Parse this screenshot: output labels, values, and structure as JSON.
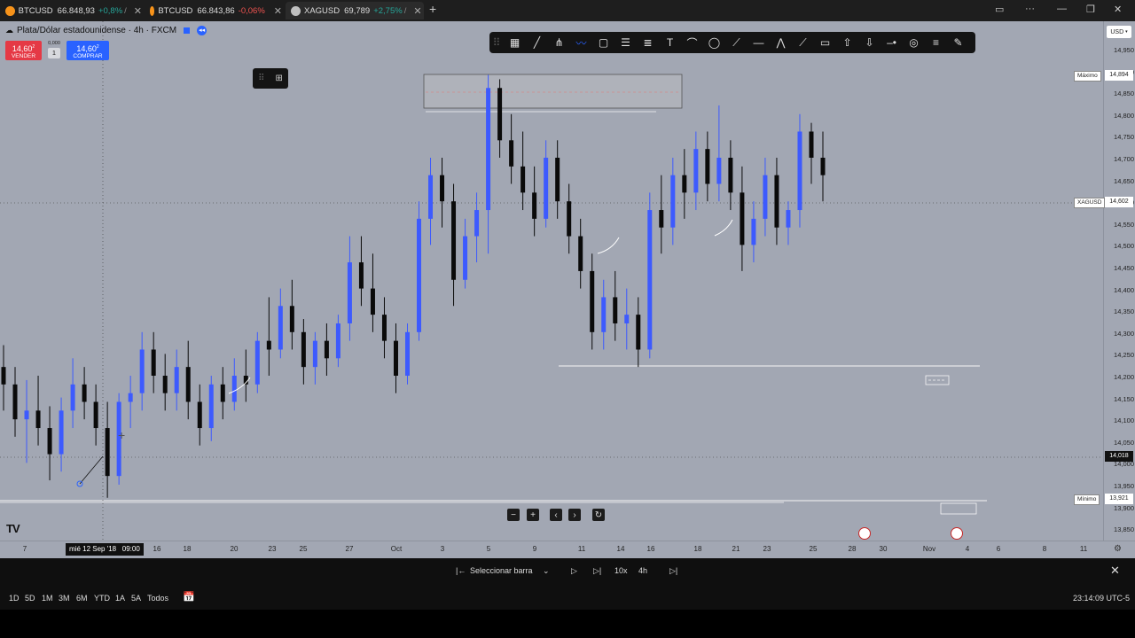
{
  "tabs": [
    {
      "symbol": "BTCUSD",
      "price": "66.848,93",
      "change": "+0,8%",
      "direction": "up",
      "suffix": "/",
      "coin_color": "#f7931a",
      "active": false
    },
    {
      "symbol": "BTCUSD",
      "price": "66.843,86",
      "change": "-0,06%",
      "direction": "down",
      "suffix": "",
      "coin_color": "#f7931a",
      "active": false
    },
    {
      "symbol": "XAGUSD",
      "price": "69,789",
      "change": "+2,75%",
      "direction": "up",
      "suffix": "/ ",
      "coin_color": "#c0c0c0",
      "active": true
    }
  ],
  "window_controls": {
    "new_tab": "+",
    "dots": "···",
    "minimize": "—",
    "restore": "❐",
    "close": "✕"
  },
  "header": {
    "title": "Plata/Dólar estadounidense · 4h · FXCM"
  },
  "trade": {
    "sell_price": "14,60",
    "sell_sup": "2",
    "sell_label": "VENDER",
    "spread_top": "0,000",
    "spread": "1",
    "buy_price": "14,60",
    "buy_sup": "2",
    "buy_label": "COMPRAR"
  },
  "currency_button": "USD",
  "price_labels": [
    "14,950",
    "14,900",
    "14,850",
    "14,800",
    "14,750",
    "14,700",
    "14,650",
    "14,600",
    "14,550",
    "14,500",
    "14,450",
    "14,400",
    "14,350",
    "14,300",
    "14,250",
    "14,200",
    "14,150",
    "14,100",
    "14,050",
    "14,000",
    "13,950",
    "13,900",
    "13,850"
  ],
  "markers": {
    "max_label": "Máximo",
    "max_value": "14,894",
    "symbol_label": "XAGUSD",
    "symbol_value": "14,602",
    "cross_value": "14,018",
    "min_label": "Mínimo",
    "min_value": "13,921"
  },
  "time_labels": [
    "7",
    "16",
    "18",
    "20",
    "23",
    "25",
    "27",
    "Oct",
    "3",
    "5",
    "9",
    "11",
    "14",
    "16",
    "18",
    "21",
    "23",
    "25",
    "28",
    "30",
    "Nov",
    "4",
    "6",
    "8",
    "11"
  ],
  "time_cursor": "mié 12 Sep '18   09:00",
  "replay": {
    "select_bar": "Seleccionar barra",
    "speed": "10x",
    "interval": "4h"
  },
  "ranges": [
    "1D",
    "5D",
    "1M",
    "3M",
    "6M",
    "YTD",
    "1A",
    "5A",
    "Todos"
  ],
  "clock": "23:14:09 UTC-5",
  "logo": "TV",
  "colors": {
    "chart_bg": "#a2a7b3",
    "up_candle": "#3d5afe",
    "down_candle": "#0a0a0a",
    "accent": "#2962ff"
  },
  "candles": [
    [
      14.22,
      14.27,
      14.12,
      14.18
    ],
    [
      14.18,
      14.22,
      14.06,
      14.1
    ],
    [
      14.1,
      14.19,
      14.0,
      14.12
    ],
    [
      14.12,
      14.2,
      14.04,
      14.08
    ],
    [
      14.08,
      14.13,
      13.96,
      14.02
    ],
    [
      14.02,
      14.15,
      13.98,
      14.12
    ],
    [
      14.12,
      14.24,
      14.08,
      14.18
    ],
    [
      14.18,
      14.22,
      14.1,
      14.14
    ],
    [
      14.14,
      14.18,
      14.04,
      14.08
    ],
    [
      14.08,
      14.14,
      13.92,
      13.97
    ],
    [
      13.97,
      14.16,
      13.95,
      14.14
    ],
    [
      14.14,
      14.2,
      14.08,
      14.16
    ],
    [
      14.16,
      14.3,
      14.12,
      14.26
    ],
    [
      14.26,
      14.3,
      14.16,
      14.2
    ],
    [
      14.2,
      14.25,
      14.12,
      14.16
    ],
    [
      14.16,
      14.26,
      14.12,
      14.22
    ],
    [
      14.22,
      14.28,
      14.1,
      14.14
    ],
    [
      14.14,
      14.18,
      14.04,
      14.08
    ],
    [
      14.08,
      14.2,
      14.05,
      14.18
    ],
    [
      14.18,
      14.22,
      14.1,
      14.14
    ],
    [
      14.14,
      14.24,
      14.12,
      14.2
    ],
    [
      14.2,
      14.26,
      14.14,
      14.18
    ],
    [
      14.18,
      14.3,
      14.16,
      14.28
    ],
    [
      14.28,
      14.38,
      14.2,
      14.26
    ],
    [
      14.26,
      14.4,
      14.24,
      14.36
    ],
    [
      14.36,
      14.42,
      14.26,
      14.3
    ],
    [
      14.3,
      14.33,
      14.18,
      14.22
    ],
    [
      14.22,
      14.3,
      14.18,
      14.28
    ],
    [
      14.28,
      14.32,
      14.2,
      14.24
    ],
    [
      14.24,
      14.34,
      14.22,
      14.32
    ],
    [
      14.32,
      14.52,
      14.28,
      14.46
    ],
    [
      14.46,
      14.52,
      14.36,
      14.4
    ],
    [
      14.4,
      14.48,
      14.3,
      14.34
    ],
    [
      14.34,
      14.38,
      14.24,
      14.28
    ],
    [
      14.28,
      14.32,
      14.16,
      14.2
    ],
    [
      14.2,
      14.32,
      14.18,
      14.3
    ],
    [
      14.3,
      14.6,
      14.28,
      14.56
    ],
    [
      14.56,
      14.7,
      14.5,
      14.66
    ],
    [
      14.66,
      14.7,
      14.54,
      14.6
    ],
    [
      14.6,
      14.64,
      14.36,
      14.42
    ],
    [
      14.42,
      14.56,
      14.4,
      14.52
    ],
    [
      14.52,
      14.62,
      14.46,
      14.58
    ],
    [
      14.58,
      14.89,
      14.48,
      14.86
    ],
    [
      14.86,
      14.88,
      14.7,
      14.74
    ],
    [
      14.74,
      14.8,
      14.64,
      14.68
    ],
    [
      14.68,
      14.76,
      14.58,
      14.62
    ],
    [
      14.62,
      14.68,
      14.52,
      14.56
    ],
    [
      14.56,
      14.74,
      14.54,
      14.7
    ],
    [
      14.7,
      14.74,
      14.56,
      14.6
    ],
    [
      14.6,
      14.64,
      14.48,
      14.52
    ],
    [
      14.52,
      14.56,
      14.4,
      14.44
    ],
    [
      14.44,
      14.48,
      14.26,
      14.3
    ],
    [
      14.3,
      14.42,
      14.26,
      14.38
    ],
    [
      14.38,
      14.44,
      14.28,
      14.32
    ],
    [
      14.32,
      14.4,
      14.26,
      14.34
    ],
    [
      14.34,
      14.38,
      14.22,
      14.26
    ],
    [
      14.26,
      14.62,
      14.24,
      14.58
    ],
    [
      14.58,
      14.66,
      14.48,
      14.54
    ],
    [
      14.54,
      14.7,
      14.5,
      14.66
    ],
    [
      14.66,
      14.72,
      14.56,
      14.62
    ],
    [
      14.62,
      14.76,
      14.58,
      14.72
    ],
    [
      14.72,
      14.76,
      14.6,
      14.64
    ],
    [
      14.64,
      14.82,
      14.6,
      14.7
    ],
    [
      14.7,
      14.74,
      14.58,
      14.62
    ],
    [
      14.62,
      14.68,
      14.44,
      14.5
    ],
    [
      14.5,
      14.6,
      14.46,
      14.56
    ],
    [
      14.56,
      14.7,
      14.52,
      14.66
    ],
    [
      14.66,
      14.7,
      14.5,
      14.54
    ],
    [
      14.54,
      14.6,
      14.5,
      14.58
    ],
    [
      14.58,
      14.8,
      14.54,
      14.76
    ],
    [
      14.76,
      14.78,
      14.64,
      14.7
    ],
    [
      14.7,
      14.76,
      14.6,
      14.66
    ]
  ]
}
